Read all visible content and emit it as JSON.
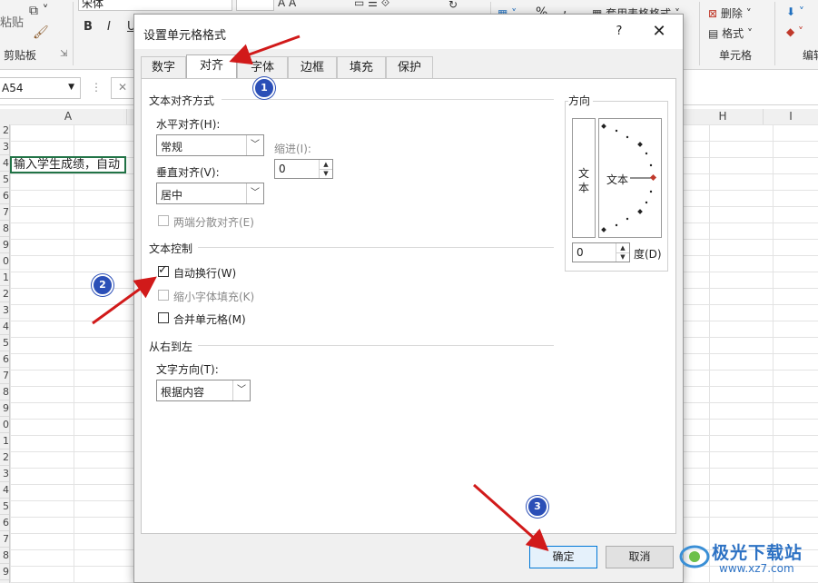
{
  "ribbon": {
    "paste_label": "粘贴",
    "clipboard_group": "剪贴板",
    "font_name": "宋体",
    "percent_symbol": "%",
    "comma_symbol": ",",
    "table_format_label": "套用表格格式",
    "delete_label": "删除",
    "format_label": "格式",
    "cells_group": "单元格",
    "edit_group": "编辑"
  },
  "namebox": {
    "value": "A54"
  },
  "column_headers": [
    "A",
    "H",
    "I"
  ],
  "row_numbers": [
    "2",
    "3",
    "4",
    "5",
    "6",
    "7",
    "8",
    "9",
    "0",
    "1",
    "2",
    "3",
    "4",
    "5",
    "6",
    "7",
    "8",
    "9",
    "0",
    "1",
    "2",
    "3",
    "4",
    "5",
    "6",
    "7",
    "8",
    "9"
  ],
  "cell_a4_text": "输入学生成绩，自动",
  "dialog": {
    "title": "设置单元格格式",
    "help": "?",
    "close": "✕",
    "tabs": [
      "数字",
      "对齐",
      "字体",
      "边框",
      "填充",
      "保护"
    ],
    "active_tab": "对齐",
    "text_alignment": {
      "section": "文本对齐方式",
      "horizontal_label": "水平对齐(H):",
      "horizontal_value": "常规",
      "vertical_label": "垂直对齐(V):",
      "vertical_value": "居中",
      "indent_label": "缩进(I):",
      "indent_value": "0",
      "distributed_label": "两端分散对齐(E)"
    },
    "text_control": {
      "section": "文本控制",
      "wrap_label": "自动换行(W)",
      "wrap_checked": true,
      "shrink_label": "缩小字体填充(K)",
      "merge_label": "合并单元格(M)"
    },
    "rtl": {
      "section": "从右到左",
      "direction_label": "文字方向(T):",
      "direction_value": "根据内容"
    },
    "orientation": {
      "section": "方向",
      "vertical_text": "文本",
      "dial_text": "文本",
      "degrees_value": "0",
      "degrees_label": "度(D)"
    },
    "ok_label": "确定",
    "cancel_label": "取消"
  },
  "annotations": {
    "badge1": "1",
    "badge2": "2",
    "badge3": "3",
    "accent_color": "#d11a1a",
    "badge_color": "#2b4fb7"
  },
  "watermark": {
    "title": "极光下载站",
    "url": "www.xz7.com"
  }
}
